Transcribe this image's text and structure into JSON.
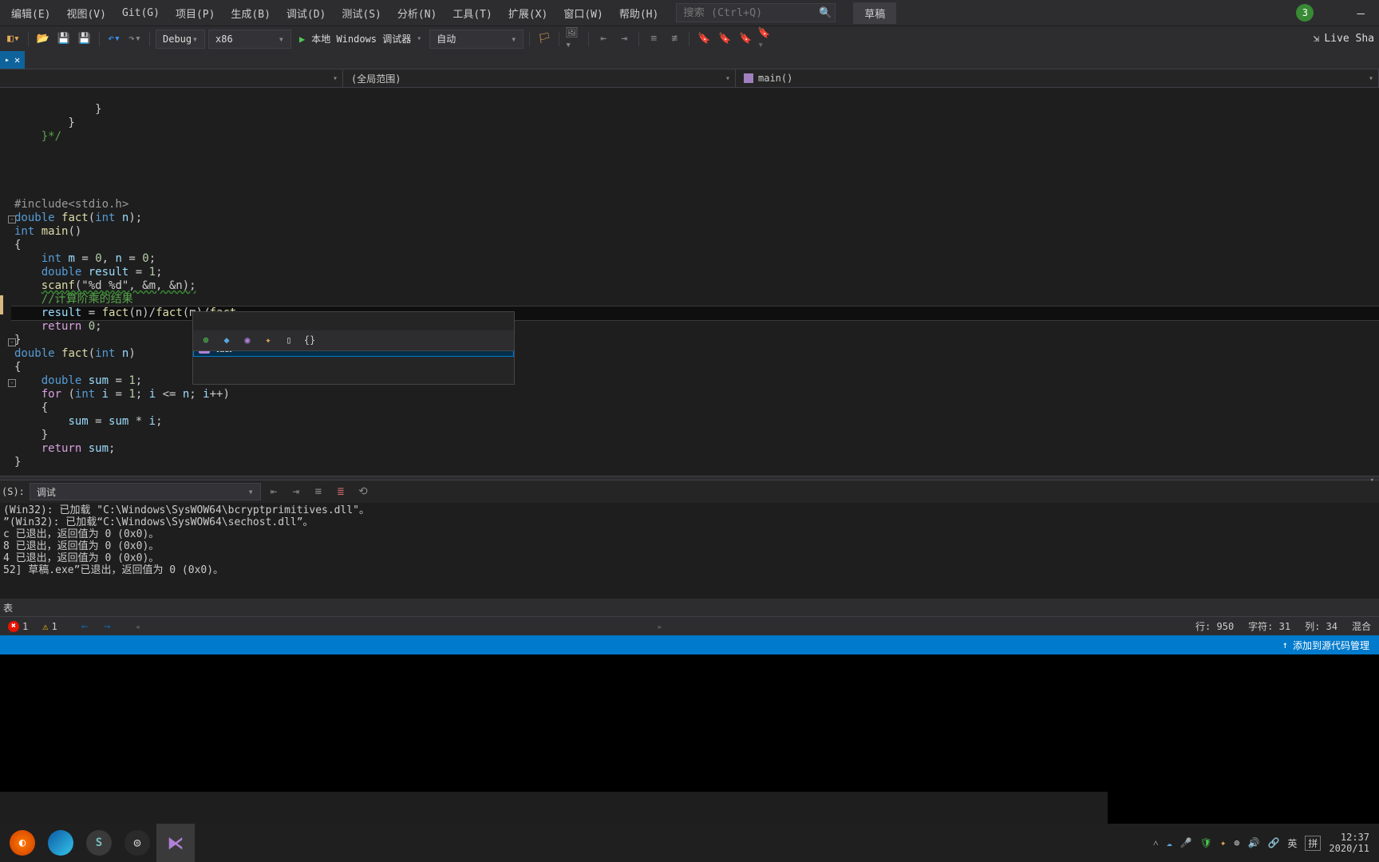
{
  "menu": {
    "items": [
      "编辑(E)",
      "视图(V)",
      "Git(G)",
      "项目(P)",
      "生成(B)",
      "调试(D)",
      "测试(S)",
      "分析(N)",
      "工具(T)",
      "扩展(X)",
      "窗口(W)",
      "帮助(H)"
    ],
    "search_placeholder": "搜索 (Ctrl+Q)",
    "draft": "草稿",
    "badge": "3"
  },
  "toolbar": {
    "config": "Debug",
    "platform": "x86",
    "debugger": "本地 Windows 调试器",
    "auto": "自动",
    "liveshare": "Live Sha"
  },
  "tabs": {
    "active_label": ""
  },
  "nav": {
    "scope": "(全局范围)",
    "member": "main()"
  },
  "code": {
    "l0": "            }",
    "l1": "        }",
    "l2": "    }*/",
    "l3": "",
    "l4": "",
    "l5": "",
    "inc": "#include<stdio.h>",
    "proto_a": "double",
    "proto_b": "fact",
    "proto_c": "int",
    "proto_d": "n",
    "main_a": "int",
    "main_b": "main",
    "brace_o": "{",
    "decl_a": "int",
    "decl_b": "m = 0, n = 0;",
    "decl2_a": "double",
    "decl2_b": "result = 1;",
    "scanf": "scanf",
    "scanf_args": "(\"%d %d\", &m, &n);",
    "comment": "//计算阶乘的结果",
    "res_line_pre": "result = ",
    "res_fact": "fact",
    "res_paren_n": "(n)",
    "res_slash1": "/",
    "res_paren_m": "(m)",
    "res_slash2": "/",
    "ret0": "return 0;",
    "brace_c": "}",
    "fn_a": "double",
    "fn_b": "fact",
    "fn_c": "int",
    "fn_d": "n",
    "sum_a": "double",
    "sum_b": "sum = 1;",
    "for_a": "for",
    "for_b": "(int i = 1; i <= n; i++)",
    "body": "sum = sum * i;",
    "retsum": "return sum;"
  },
  "intellisense": {
    "item": "fact"
  },
  "output": {
    "source_label": "(S):",
    "source": "调试",
    "lines": [
      "(Win32): 已加载 \"C:\\Windows\\SysWOW64\\bcryptprimitives.dll\"。",
      "”(Win32): 已加载“C:\\Windows\\SysWOW64\\sechost.dll”。",
      "c 已退出，返回值为 0 (0x0)。",
      "8 已退出，返回值为 0 (0x0)。",
      "4 已退出，返回值为 0 (0x0)。",
      "52] 草稿.exe”已退出，返回值为 0 (0x0)。"
    ]
  },
  "bottom_tab": "表",
  "errorbar": {
    "errors": "1",
    "warnings": "1",
    "row": "行: 950",
    "char": "字符: 31",
    "col": "列: 34",
    "mode": "混合"
  },
  "bluebar": {
    "text": "添加到源代码管理"
  },
  "tray": {
    "ime_lang": "英",
    "ime_mode": "拼",
    "time": "12:37",
    "date": "2020/11"
  }
}
